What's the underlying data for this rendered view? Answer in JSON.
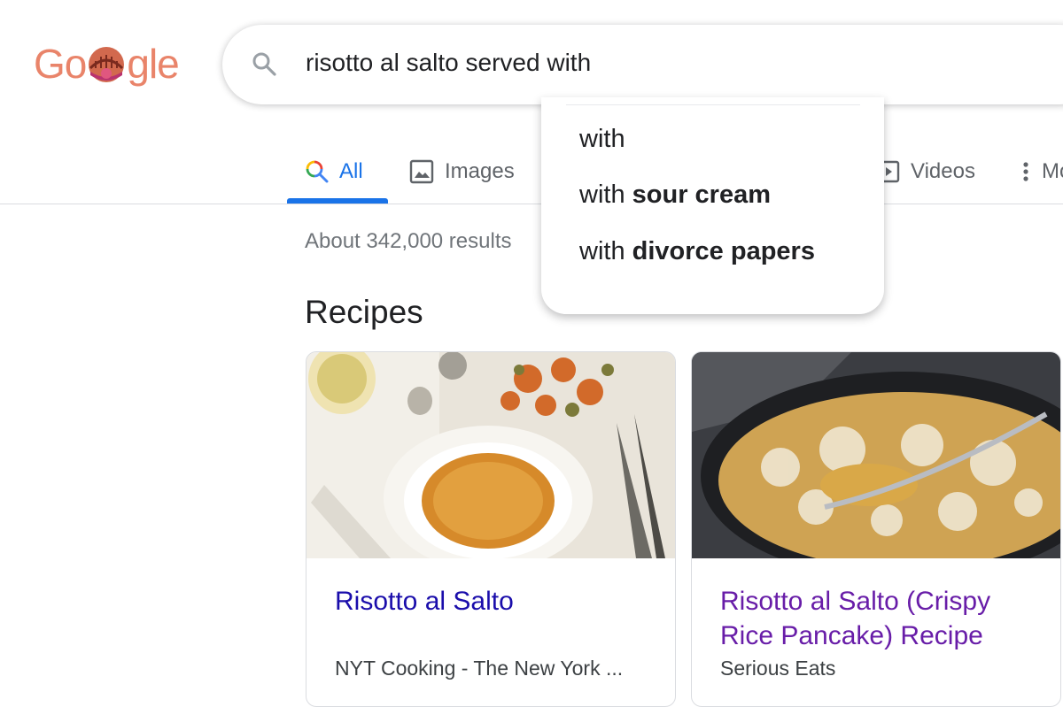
{
  "logo": {
    "prefix": "Go",
    "suffix": "gle"
  },
  "search": {
    "query": "risotto al salto served with"
  },
  "tabs": [
    {
      "label": "All"
    },
    {
      "label": "Images"
    },
    {
      "label": "Videos"
    },
    {
      "label": "Mo"
    }
  ],
  "suggestions": [
    {
      "plain": "with",
      "bold": ""
    },
    {
      "plain": "with ",
      "bold": "sour cream"
    },
    {
      "plain": "with ",
      "bold": "divorce papers"
    }
  ],
  "stats": "About 342,000 results",
  "section": {
    "title": "Recipes"
  },
  "cards": [
    {
      "title": "Risotto al Salto",
      "source": "NYT Cooking - The New York ..."
    },
    {
      "title": "Risotto al Salto (Crispy Rice Pancake) Recipe",
      "source": "Serious Eats"
    }
  ],
  "colors": {
    "accent": "#1a73e8",
    "link": "#1a0dab",
    "visited_link": "#681da8",
    "logo": "#e9846a"
  }
}
